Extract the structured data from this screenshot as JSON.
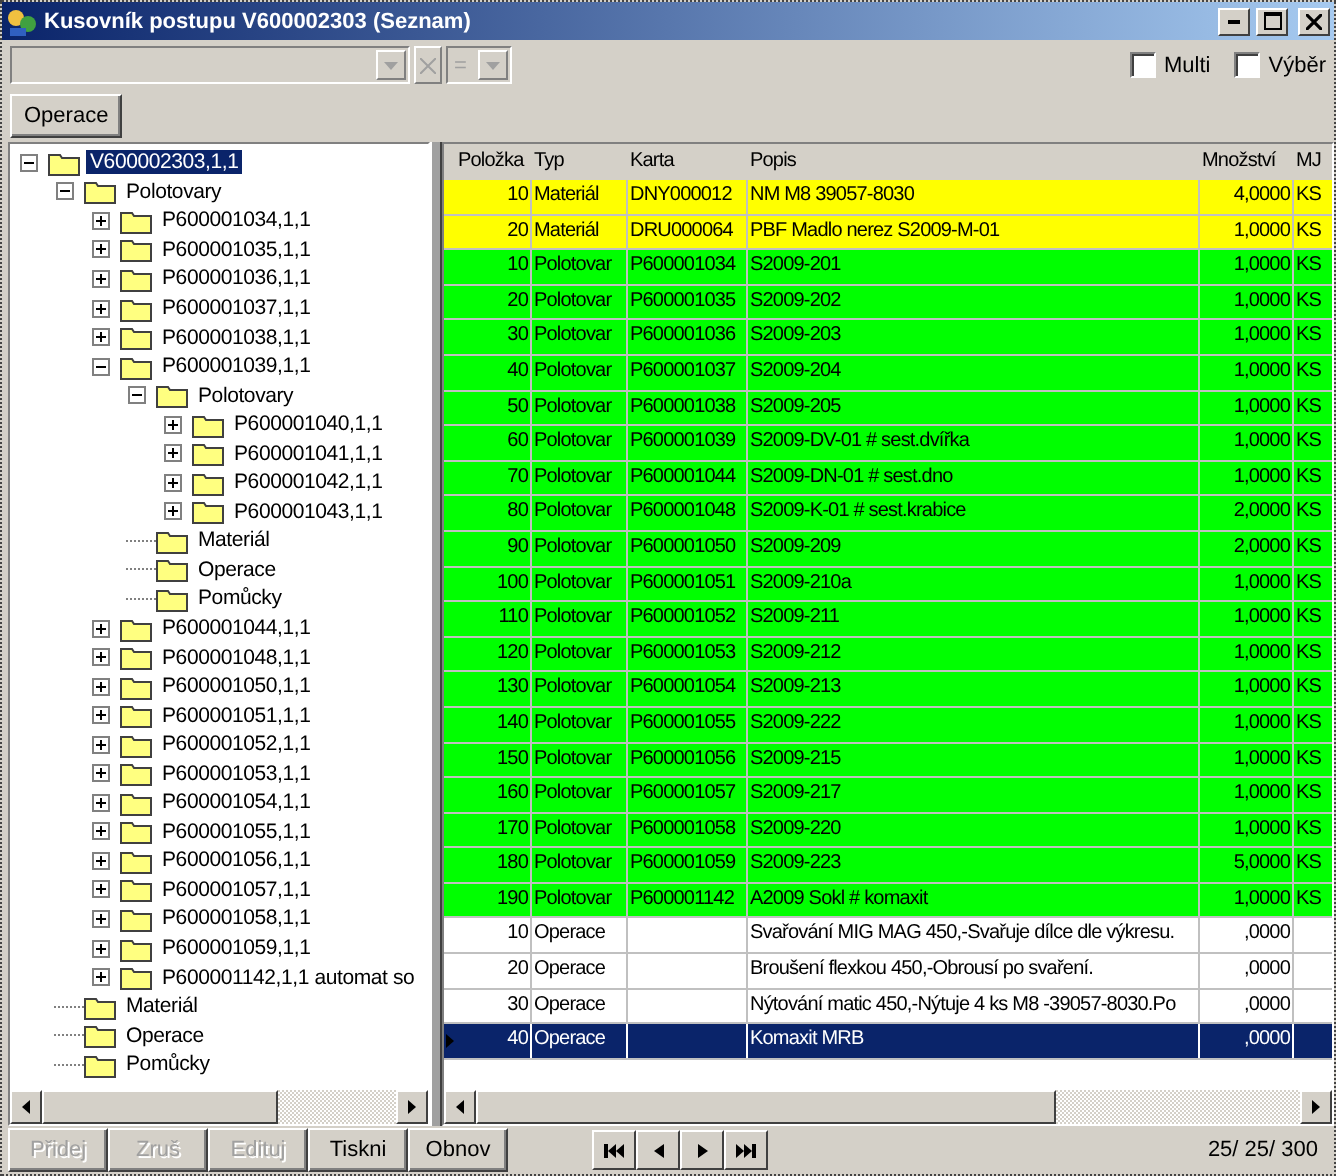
{
  "window": {
    "title": "Kusovník postupu V600002303 (Seznam)"
  },
  "filter": {
    "operator": "=",
    "checkboxes": [
      {
        "label": "Multi",
        "checked": false
      },
      {
        "label": "Výběr",
        "checked": false
      }
    ]
  },
  "toolbar": {
    "buttons": [
      "Operace"
    ]
  },
  "tree": [
    {
      "label": "V600002303,1,1",
      "selected": true,
      "expanded": true,
      "children": [
        {
          "label": "Polotovary",
          "selected": false,
          "expanded": true,
          "children": [
            {
              "label": "P600001034,1,1",
              "selected": false,
              "expanded": false
            },
            {
              "label": "P600001035,1,1",
              "selected": false,
              "expanded": false
            },
            {
              "label": "P600001036,1,1",
              "selected": false,
              "expanded": false
            },
            {
              "label": "P600001037,1,1",
              "selected": false,
              "expanded": false
            },
            {
              "label": "P600001038,1,1",
              "selected": false,
              "expanded": false
            },
            {
              "label": "P600001039,1,1",
              "selected": false,
              "expanded": true,
              "children": [
                {
                  "label": "Polotovary",
                  "selected": false,
                  "expanded": true,
                  "children": [
                    {
                      "label": "P600001040,1,1",
                      "selected": false,
                      "expanded": false
                    },
                    {
                      "label": "P600001041,1,1",
                      "selected": false,
                      "expanded": false
                    },
                    {
                      "label": "P600001042,1,1",
                      "selected": false,
                      "expanded": false
                    },
                    {
                      "label": "P600001043,1,1",
                      "selected": false,
                      "expanded": false
                    }
                  ]
                },
                {
                  "label": "Materiál",
                  "selected": false
                },
                {
                  "label": "Operace",
                  "selected": false
                },
                {
                  "label": "Pomůcky",
                  "selected": false
                }
              ]
            },
            {
              "label": "P600001044,1,1",
              "selected": false,
              "expanded": false
            },
            {
              "label": "P600001048,1,1",
              "selected": false,
              "expanded": false
            },
            {
              "label": "P600001050,1,1",
              "selected": false,
              "expanded": false
            },
            {
              "label": "P600001051,1,1",
              "selected": false,
              "expanded": false
            },
            {
              "label": "P600001052,1,1",
              "selected": false,
              "expanded": false
            },
            {
              "label": "P600001053,1,1",
              "selected": false,
              "expanded": false
            },
            {
              "label": "P600001054,1,1",
              "selected": false,
              "expanded": false
            },
            {
              "label": "P600001055,1,1",
              "selected": false,
              "expanded": false
            },
            {
              "label": "P600001056,1,1",
              "selected": false,
              "expanded": false
            },
            {
              "label": "P600001057,1,1",
              "selected": false,
              "expanded": false
            },
            {
              "label": "P600001058,1,1",
              "selected": false,
              "expanded": false
            },
            {
              "label": "P600001059,1,1",
              "selected": false,
              "expanded": false
            },
            {
              "label": "P600001142,1,1 automat so",
              "selected": false,
              "expanded": false
            }
          ]
        },
        {
          "label": "Materiál",
          "selected": false
        },
        {
          "label": "Operace",
          "selected": false
        },
        {
          "label": "Pomůcky",
          "selected": false
        }
      ]
    }
  ],
  "table": {
    "columns": [
      "Položka",
      "Typ",
      "Karta",
      "Popis",
      "Množství",
      "MJ"
    ],
    "rows": [
      {
        "cells": [
          "10",
          "Materiál",
          "DNY000012",
          "NM M8 39057-8030",
          "4,0000",
          "KS"
        ],
        "color": "#ffff00",
        "selected": false
      },
      {
        "cells": [
          "20",
          "Materiál",
          "DRU000064",
          "PBF Madlo nerez  S2009-M-01",
          "1,0000",
          "KS"
        ],
        "color": "#ffff00",
        "selected": false
      },
      {
        "cells": [
          "10",
          "Polotovar",
          "P600001034",
          "S2009-201",
          "1,0000",
          "KS"
        ],
        "color": "#00ff00",
        "selected": false
      },
      {
        "cells": [
          "20",
          "Polotovar",
          "P600001035",
          "S2009-202",
          "1,0000",
          "KS"
        ],
        "color": "#00ff00",
        "selected": false
      },
      {
        "cells": [
          "30",
          "Polotovar",
          "P600001036",
          "S2009-203",
          "1,0000",
          "KS"
        ],
        "color": "#00ff00",
        "selected": false
      },
      {
        "cells": [
          "40",
          "Polotovar",
          "P600001037",
          "S2009-204",
          "1,0000",
          "KS"
        ],
        "color": "#00ff00",
        "selected": false
      },
      {
        "cells": [
          "50",
          "Polotovar",
          "P600001038",
          "S2009-205",
          "1,0000",
          "KS"
        ],
        "color": "#00ff00",
        "selected": false
      },
      {
        "cells": [
          "60",
          "Polotovar",
          "P600001039",
          "S2009-DV-01 # sest.dvířka",
          "1,0000",
          "KS"
        ],
        "color": "#00ff00",
        "selected": false
      },
      {
        "cells": [
          "70",
          "Polotovar",
          "P600001044",
          "S2009-DN-01 # sest.dno",
          "1,0000",
          "KS"
        ],
        "color": "#00ff00",
        "selected": false
      },
      {
        "cells": [
          "80",
          "Polotovar",
          "P600001048",
          "S2009-K-01 # sest.krabice",
          "2,0000",
          "KS"
        ],
        "color": "#00ff00",
        "selected": false
      },
      {
        "cells": [
          "90",
          "Polotovar",
          "P600001050",
          "S2009-209",
          "2,0000",
          "KS"
        ],
        "color": "#00ff00",
        "selected": false
      },
      {
        "cells": [
          "100",
          "Polotovar",
          "P600001051",
          "S2009-210a",
          "1,0000",
          "KS"
        ],
        "color": "#00ff00",
        "selected": false
      },
      {
        "cells": [
          "110",
          "Polotovar",
          "P600001052",
          "S2009-211",
          "1,0000",
          "KS"
        ],
        "color": "#00ff00",
        "selected": false
      },
      {
        "cells": [
          "120",
          "Polotovar",
          "P600001053",
          "S2009-212",
          "1,0000",
          "KS"
        ],
        "color": "#00ff00",
        "selected": false
      },
      {
        "cells": [
          "130",
          "Polotovar",
          "P600001054",
          "S2009-213",
          "1,0000",
          "KS"
        ],
        "color": "#00ff00",
        "selected": false
      },
      {
        "cells": [
          "140",
          "Polotovar",
          "P600001055",
          "S2009-222",
          "1,0000",
          "KS"
        ],
        "color": "#00ff00",
        "selected": false
      },
      {
        "cells": [
          "150",
          "Polotovar",
          "P600001056",
          "S2009-215",
          "1,0000",
          "KS"
        ],
        "color": "#00ff00",
        "selected": false
      },
      {
        "cells": [
          "160",
          "Polotovar",
          "P600001057",
          "S2009-217",
          "1,0000",
          "KS"
        ],
        "color": "#00ff00",
        "selected": false
      },
      {
        "cells": [
          "170",
          "Polotovar",
          "P600001058",
          "S2009-220",
          "1,0000",
          "KS"
        ],
        "color": "#00ff00",
        "selected": false
      },
      {
        "cells": [
          "180",
          "Polotovar",
          "P600001059",
          "S2009-223",
          "5,0000",
          "KS"
        ],
        "color": "#00ff00",
        "selected": false
      },
      {
        "cells": [
          "190",
          "Polotovar",
          "P600001142",
          "A2009 Sokl # komaxit",
          "1,0000",
          "KS"
        ],
        "color": "#00ff00",
        "selected": false
      },
      {
        "cells": [
          "10",
          "Operace",
          "",
          "Svařování MIG MAG 450,-Svařuje dílce dle výkresu.",
          ",0000",
          ""
        ],
        "color": "#ffffff",
        "selected": false
      },
      {
        "cells": [
          "20",
          "Operace",
          "",
          "Broušení flexkou 450,-Obrousí po svaření.",
          ",0000",
          ""
        ],
        "color": "#ffffff",
        "selected": false
      },
      {
        "cells": [
          "30",
          "Operace",
          "",
          "Nýtování matic 450,-Nýtuje 4 ks M8 -39057-8030.Po",
          ",0000",
          ""
        ],
        "color": "#ffffff",
        "selected": false
      },
      {
        "cells": [
          "40",
          "Operace",
          "",
          "Komaxit MRB",
          ",0000",
          ""
        ],
        "selected": true
      }
    ]
  },
  "actions": [
    {
      "label": "Přidej",
      "disabled": true
    },
    {
      "label": "Zruš",
      "disabled": true
    },
    {
      "label": "Edituj",
      "disabled": true
    },
    {
      "label": "Tiskni",
      "disabled": false
    },
    {
      "label": "Obnov",
      "disabled": false
    }
  ],
  "status": "25/ 25/ 300"
}
